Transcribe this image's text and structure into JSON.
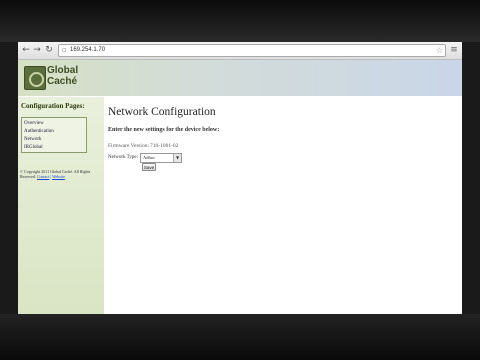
{
  "browser": {
    "url": "169.254.1.70"
  },
  "header": {
    "logo_line1": "Global",
    "logo_line2": "Caché"
  },
  "sidebar": {
    "title": "Configuration Pages:",
    "items": [
      {
        "label": "Overview"
      },
      {
        "label": "Authentication"
      },
      {
        "label": "Network"
      },
      {
        "label": "IRGlobal"
      }
    ],
    "copyright": "© Copyright 2011 Global Caché. All Rights Reserved.",
    "link1": "Contact",
    "link_sep": " | ",
    "link2": "Website"
  },
  "main": {
    "title": "Network Configuration",
    "instruction": "Enter the new settings for the device below:",
    "firmware_label": "Firmware Version:",
    "firmware_value": "710-1001-02",
    "network_type_label": "Network Type:",
    "network_type_value": "Adhoc",
    "save_label": "Save"
  }
}
